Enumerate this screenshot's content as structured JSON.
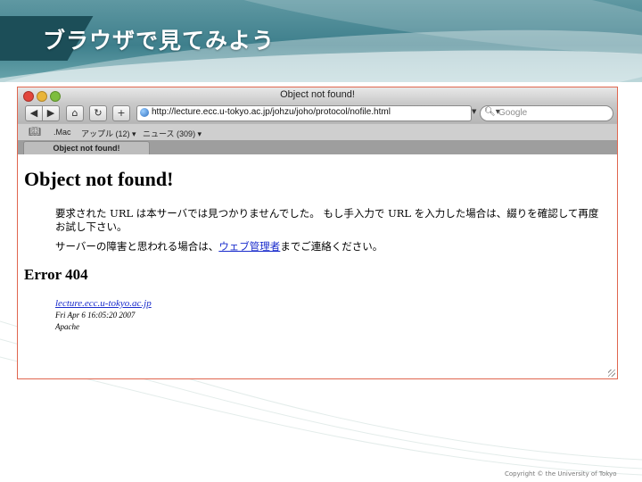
{
  "slide": {
    "title": "ブラウザで見てみよう",
    "copyright": "Copyright © the University of Tokyo"
  },
  "browser": {
    "window_title": "Object not found!",
    "toolbar": {
      "back_glyph": "◀",
      "forward_glyph": "▶",
      "home_glyph": "⌂",
      "reload_glyph": "↻",
      "add_glyph": "+",
      "url": "http://lecture.ecc.u-tokyo.ac.jp/johzu/joho/protocol/nofile.html",
      "search_placeholder": "Google"
    },
    "bookmarks": [
      {
        "label": ".Mac"
      },
      {
        "label": "アップル (12) ▾"
      },
      {
        "label": "ニュース (309) ▾"
      }
    ],
    "tab": {
      "label": "Object not found!"
    }
  },
  "page": {
    "heading": "Object not found!",
    "message": "要求された URL は本サーバでは見つかりませんでした。 もし手入力で URL を入力した場合は、綴りを確認して再度お試し下さい。",
    "contact_prefix": "サーバーの障害と思われる場合は、",
    "contact_link": "ウェブ管理者",
    "contact_suffix": "までご連絡ください。",
    "error_heading": "Error 404",
    "server_host": "lecture.ecc.u-tokyo.ac.jp",
    "server_date": "Fri Apr 6 16:05:20 2007",
    "server_software": "Apache"
  },
  "colors": {
    "header_teal": "#3e7f8c",
    "window_border": "#e0664f",
    "link_blue": "#1a2ccc"
  }
}
